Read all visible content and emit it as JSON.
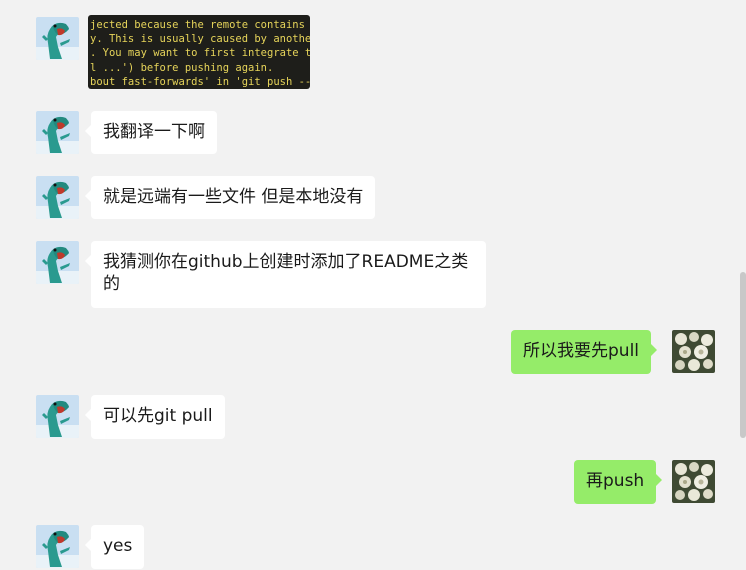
{
  "screenshot_lines": [
    "jected because the remote contains w",
    "y. This is usually caused by another",
    ". You may want to first integrate th",
    "l ...') before pushing again.",
    "bout fast-forwards' in 'git push --h"
  ],
  "messages": [
    {
      "side": "left",
      "text": "我翻译一下啊"
    },
    {
      "side": "left",
      "text": "就是远端有一些文件 但是本地没有"
    },
    {
      "side": "left",
      "text": "我猜测你在github上创建时添加了README之类的"
    },
    {
      "side": "right",
      "text": "所以我要先pull"
    },
    {
      "side": "left",
      "text": "可以先git pull"
    },
    {
      "side": "right",
      "text": "再push"
    },
    {
      "side": "left",
      "text": "yes"
    }
  ],
  "colors": {
    "background": "#f2f2f2",
    "bubble_left": "#ffffff",
    "bubble_right": "#95ec69",
    "terminal_bg": "#1e1e1a",
    "terminal_text": "#e6d45a"
  }
}
